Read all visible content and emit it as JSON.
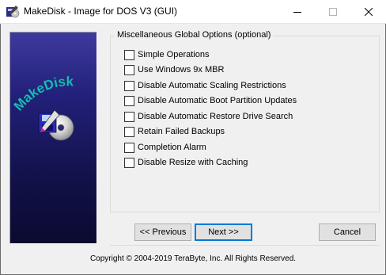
{
  "window": {
    "title": "MakeDisk - Image for DOS V3 (GUI)"
  },
  "logo": {
    "text": "MakeDisk"
  },
  "options_group": {
    "title": "Miscellaneous Global Options (optional)",
    "options": [
      {
        "label": "Simple Operations",
        "checked": false
      },
      {
        "label": "Use Windows 9x MBR",
        "checked": false
      },
      {
        "label": "Disable Automatic Scaling Restrictions",
        "checked": false
      },
      {
        "label": "Disable Automatic Boot Partition Updates",
        "checked": false
      },
      {
        "label": "Disable Automatic Restore Drive Search",
        "checked": false
      },
      {
        "label": "Retain Failed Backups",
        "checked": false
      },
      {
        "label": "Completion Alarm",
        "checked": false
      },
      {
        "label": "Disable Resize with Caching",
        "checked": false
      }
    ]
  },
  "buttons": {
    "previous": "<< Previous",
    "next": "Next >>",
    "cancel": "Cancel"
  },
  "footer": {
    "copyright": "Copyright © 2004-2019 TeraByte, Inc.  All Rights Reserved."
  }
}
